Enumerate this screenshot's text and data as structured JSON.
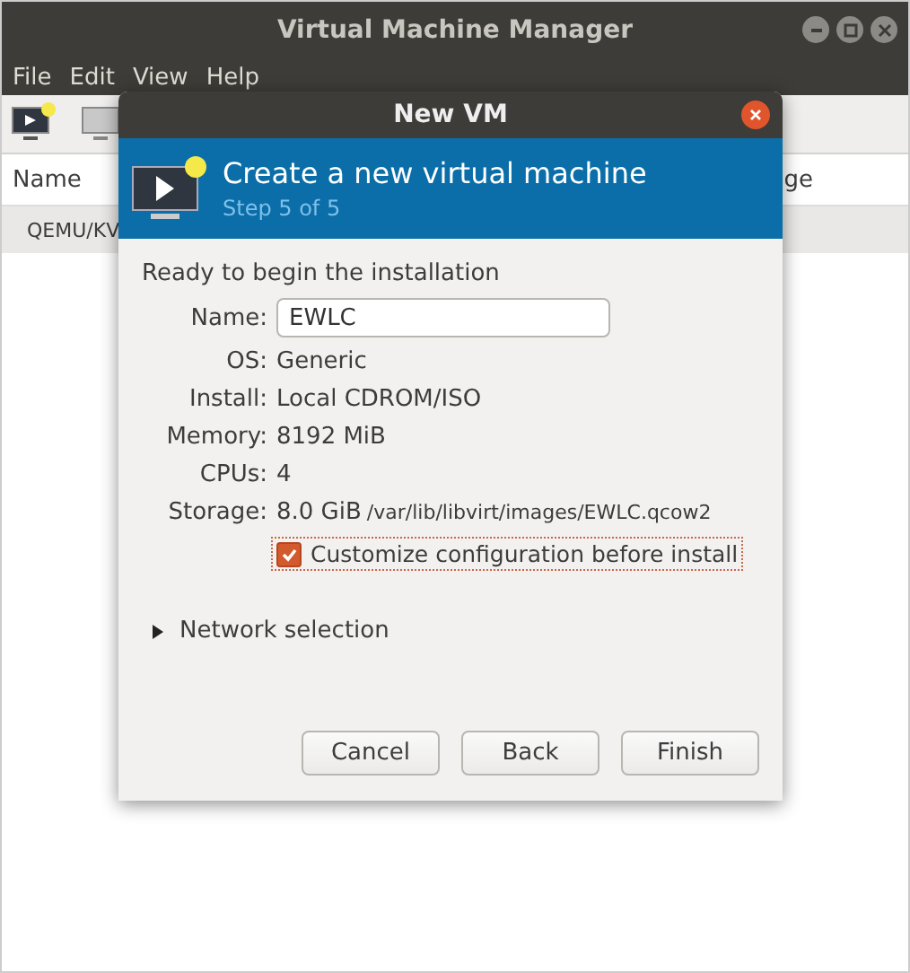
{
  "window": {
    "title": "Virtual Machine Manager"
  },
  "menu": [
    "File",
    "Edit",
    "View",
    "Help"
  ],
  "list": {
    "columns": [
      "Name",
      "ge"
    ],
    "rows": [
      "QEMU/KV"
    ]
  },
  "dialog": {
    "title": "New VM",
    "heading": "Create a new virtual machine",
    "step": "Step 5 of 5",
    "intro": "Ready to begin the installation",
    "name_field": {
      "label": "Name:",
      "value": "EWLC"
    },
    "details": [
      {
        "label": "OS:",
        "value": "Generic"
      },
      {
        "label": "Install:",
        "value": "Local CDROM/ISO"
      },
      {
        "label": "Memory:",
        "value": "8192 MiB"
      },
      {
        "label": "CPUs:",
        "value": "4"
      },
      {
        "label": "Storage:",
        "value": "8.0 GiB",
        "detail": "/var/lib/libvirt/images/EWLC.qcow2"
      }
    ],
    "customize": {
      "label": "Customize configuration before install",
      "checked": true
    },
    "network": {
      "label": "Network selection",
      "expanded": false
    },
    "buttons": [
      "Cancel",
      "Back",
      "Finish"
    ]
  }
}
